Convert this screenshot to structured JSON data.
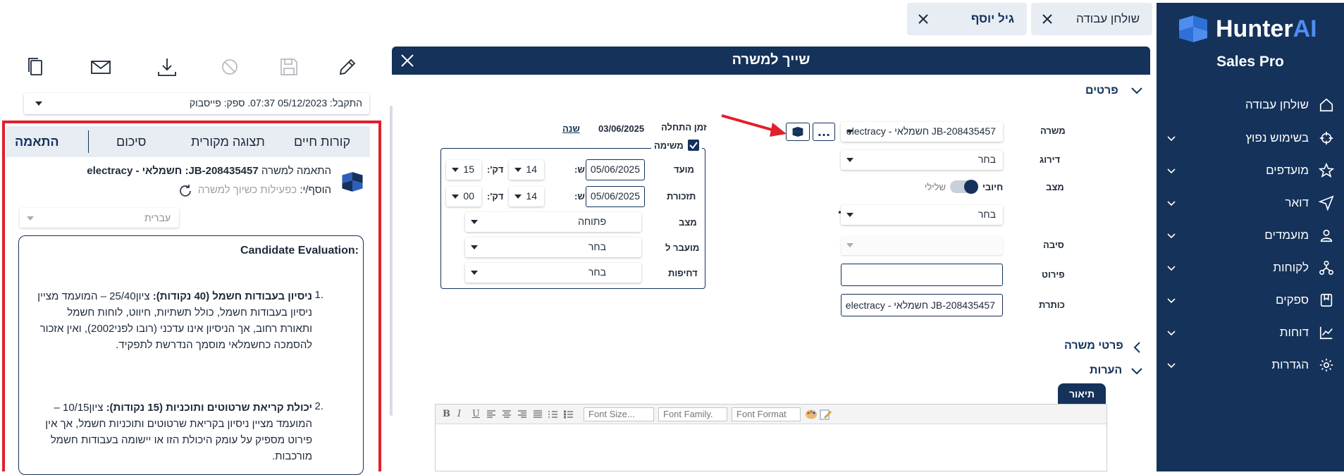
{
  "sidebar": {
    "brand_main": "Hunter",
    "brand_ai": "AI",
    "product": "Sales Pro",
    "items": [
      {
        "label": "שולחן עבודה",
        "icon": "home-icon",
        "has_chevron": false
      },
      {
        "label": "בשימוש נפוץ",
        "icon": "crosshair-icon",
        "has_chevron": true
      },
      {
        "label": "מועדפים",
        "icon": "star-icon",
        "has_chevron": true
      },
      {
        "label": "דואר",
        "icon": "send-icon",
        "has_chevron": true
      },
      {
        "label": "מועמדים",
        "icon": "person-icon",
        "has_chevron": true
      },
      {
        "label": "לקוחות",
        "icon": "network-icon",
        "has_chevron": true
      },
      {
        "label": "ספקים",
        "icon": "supplier-icon",
        "has_chevron": true
      },
      {
        "label": "דוחות",
        "icon": "chart-icon",
        "has_chevron": true
      },
      {
        "label": "הגדרות",
        "icon": "gear-icon",
        "has_chevron": true
      }
    ]
  },
  "top_tabs": [
    {
      "label": "שולחן עבודה"
    },
    {
      "label": "גיל יוסף"
    }
  ],
  "modal": {
    "title": "שייך למשרה",
    "sections": {
      "details": "פרטים",
      "job_details": "פרטי משרה",
      "notes": "הערות"
    },
    "labels": {
      "job": "משרה",
      "rating": "דירוג",
      "status": "מצב",
      "reason": "סיבה",
      "detail": "פירוט",
      "headline": "כותרת",
      "start_time": "זמן התחלה",
      "task": "משימה",
      "due": "מועד",
      "reminder": "תזכורת",
      "task_status": "מצב",
      "transferred_to": "מועבר ל",
      "urgency": "דחיפות",
      "hour": "ש:",
      "minute": "דק':"
    },
    "values": {
      "job": "JB-208435457 חשמלאי - electracy",
      "rating": "בחר",
      "toggle_positive": "חיובי",
      "toggle_negative": "שלילי",
      "reason_rating": "בחר",
      "reason": "",
      "detail": "",
      "headline": "JB-208435457 חשמלאי - electracy",
      "start_date": "03/06/2025",
      "year_link": "שנה",
      "due_date": "05/06/2025",
      "due_hour": "14",
      "due_min": "15",
      "reminder_date": "05/06/2025",
      "reminder_hour": "14",
      "reminder_min": "00",
      "task_status": "פתוחה",
      "transferred_to": "בחר",
      "urgency": "בחר",
      "more_button": "..."
    },
    "editor": {
      "tab": "תיאור",
      "font_size": "Font Size...",
      "font_family": "Font Family.",
      "font_format": "Font Format"
    }
  },
  "left_panel": {
    "received": "התקבל: 05/12/2023 07:37. ספק: פייסבוק",
    "tabs": [
      {
        "label": "התאמה",
        "active": true
      },
      {
        "label": "סיכום",
        "active": false
      },
      {
        "label": "תצוגה מקורית",
        "active": false
      },
      {
        "label": "קורות חיים",
        "active": false
      }
    ],
    "match_prefix": "התאמה למשרה",
    "match_job": "JB-208435457: חשמלאי - electracy",
    "added_by": "הוסף/י:",
    "added_muted": "כפעילות  כשיוך למשרה",
    "language": "עברית",
    "eval_title": "Candidate Evaluation:",
    "eval_items": [
      {
        "num": "1.",
        "bold": "ניסיון בעבודות חשמל (40 נקודות):",
        "text": " ציון25/40 – המועמד מציין ניסיון בעבודות חשמל, כולל תשתיות, חיווט, לוחות חשמל ותאורת רחוב, אך הניסיון אינו עדכני (רובו לפני2002), ואין אזכור להסמכה כחשמלאי מוסמך הנדרשת לתפקיד."
      },
      {
        "num": "2.",
        "bold": "יכולת קריאת שרטוטים ותוכניות (15 נקודות):",
        "text": " ציון10/15 – המועמד מציין ניסיון בקריאת שרטוטים ותוכניות חשמל, אך אין פירוט מספיק על עומק היכולת הזו או יישומה בעבודות חשמל מורכבות."
      }
    ]
  },
  "colors": {
    "navy": "#14325a",
    "highlight_red": "#e0202a",
    "tab_bg": "#e8edf4",
    "brand_blue": "#4f8df0"
  }
}
